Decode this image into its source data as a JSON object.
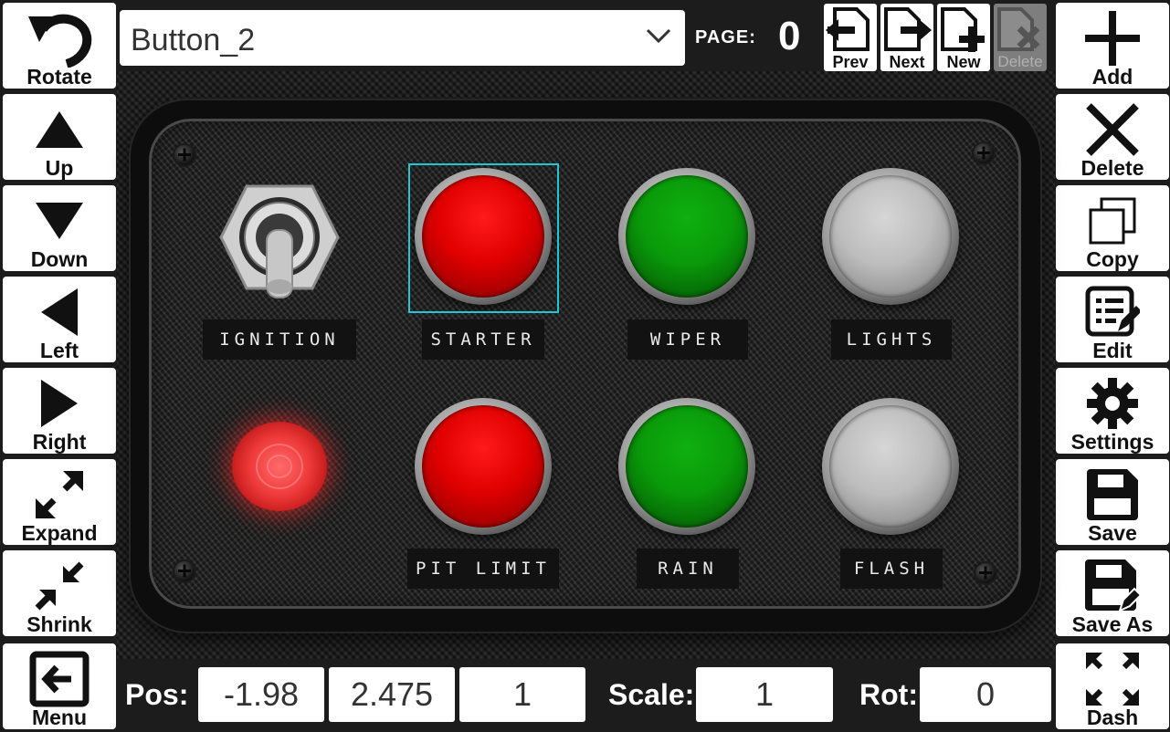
{
  "left_toolbar": [
    {
      "label": "Rotate",
      "icon": "rotate-icon"
    },
    {
      "label": "Up",
      "icon": "arrow-up-icon"
    },
    {
      "label": "Down",
      "icon": "arrow-down-icon"
    },
    {
      "label": "Left",
      "icon": "arrow-left-icon"
    },
    {
      "label": "Right",
      "icon": "arrow-right-icon"
    },
    {
      "label": "Expand",
      "icon": "expand-icon"
    },
    {
      "label": "Shrink",
      "icon": "shrink-icon"
    },
    {
      "label": "Menu",
      "icon": "exit-menu-icon"
    }
  ],
  "right_toolbar": [
    {
      "label": "Add",
      "icon": "plus-icon"
    },
    {
      "label": "Delete",
      "icon": "x-icon"
    },
    {
      "label": "Copy",
      "icon": "copy-icon"
    },
    {
      "label": "Edit",
      "icon": "edit-list-icon"
    },
    {
      "label": "Settings",
      "icon": "gear-icon"
    },
    {
      "label": "Save",
      "icon": "floppy-icon"
    },
    {
      "label": "Save As",
      "icon": "floppy-pen-icon"
    },
    {
      "label": "Dash",
      "icon": "fullscreen-icon"
    }
  ],
  "header": {
    "selected_element": "Button_2",
    "page_label": "PAGE:",
    "page_number": "0",
    "page_buttons": [
      {
        "label": "Prev",
        "icon": "page-prev-icon",
        "enabled": true
      },
      {
        "label": "Next",
        "icon": "page-next-icon",
        "enabled": true
      },
      {
        "label": "New",
        "icon": "page-new-icon",
        "enabled": true
      },
      {
        "label": "Delete",
        "icon": "page-delete-icon",
        "enabled": false
      }
    ]
  },
  "panel": {
    "labels": {
      "ignition": "IGNITION",
      "starter": "STARTER",
      "wiper": "WIPER",
      "lights": "LIGHTS",
      "pit_limit": "PIT LIMIT",
      "rain": "RAIN",
      "flash": "FLASH"
    },
    "selected": "STARTER",
    "colors": {
      "red": "#e00000",
      "green": "#0a9a0a",
      "gray": "#bdbdbd",
      "selection": "#22c5d3",
      "led": "#ee3a3a"
    }
  },
  "footer": {
    "pos_label": "Pos:",
    "pos_x": "-1.98",
    "pos_y": "2.475",
    "pos_z": "1",
    "scale_label": "Scale:",
    "scale": "1",
    "rot_label": "Rot:",
    "rot": "0"
  }
}
